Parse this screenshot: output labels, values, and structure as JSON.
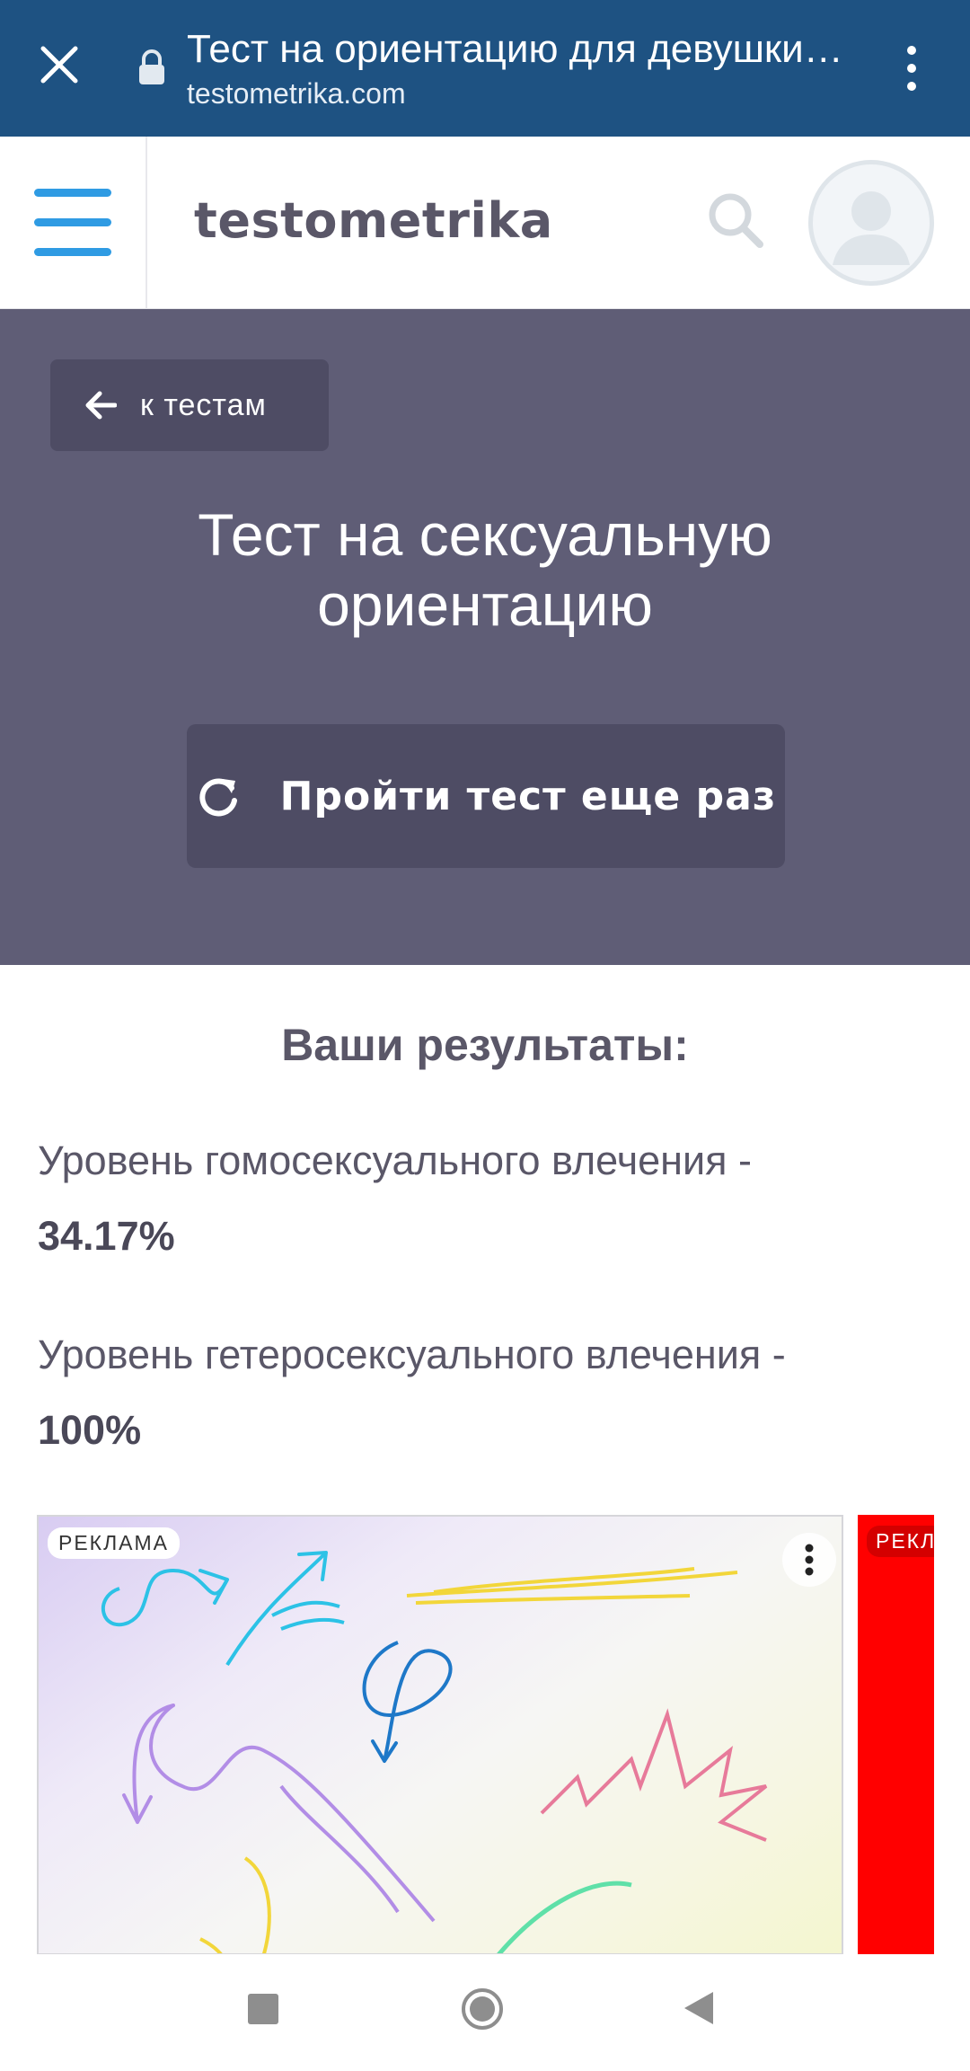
{
  "browser": {
    "title": "Тест на ориентацию для девушки…",
    "url": "testometrika.com"
  },
  "header": {
    "logo": "testometrika"
  },
  "hero": {
    "back_label": "к тестам",
    "title": "Тест на сексуальную ориентацию",
    "retry_label": "Пройти тест еще раз"
  },
  "results": {
    "heading": "Ваши результаты:",
    "items": [
      {
        "label": "Уровень гомосексуального влечения -",
        "value": "34.17%"
      },
      {
        "label": "Уровень гетеросексуального влечения -",
        "value": "100%"
      }
    ]
  },
  "ads": {
    "badge": "РЕКЛАМА",
    "badge_2": "РЕКЛ"
  },
  "colors": {
    "browser_bar": "#1e5282",
    "hero_bg": "#5f5d76",
    "button_bg": "#4e4c64",
    "accent_blue": "#2f9be3",
    "text_dark": "#5a5768",
    "ad_red": "#ff0000"
  },
  "icons": {
    "close": "close-icon",
    "lock": "lock-icon",
    "menu": "more-vert-icon",
    "hamburger": "hamburger-icon",
    "search": "search-icon",
    "avatar": "user-avatar-icon",
    "back": "arrow-left-icon",
    "retry": "refresh-icon"
  }
}
